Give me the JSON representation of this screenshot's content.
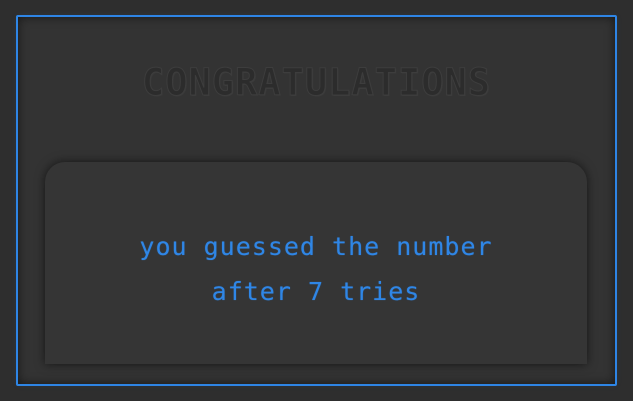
{
  "screen": {
    "title": "CONGRATULATIONS",
    "message_line1": "you guessed the number",
    "message_line2": "after 7 tries"
  },
  "colors": {
    "accent": "#2f86e6",
    "background": "#333333",
    "title_dim": "#2c2c2c"
  }
}
